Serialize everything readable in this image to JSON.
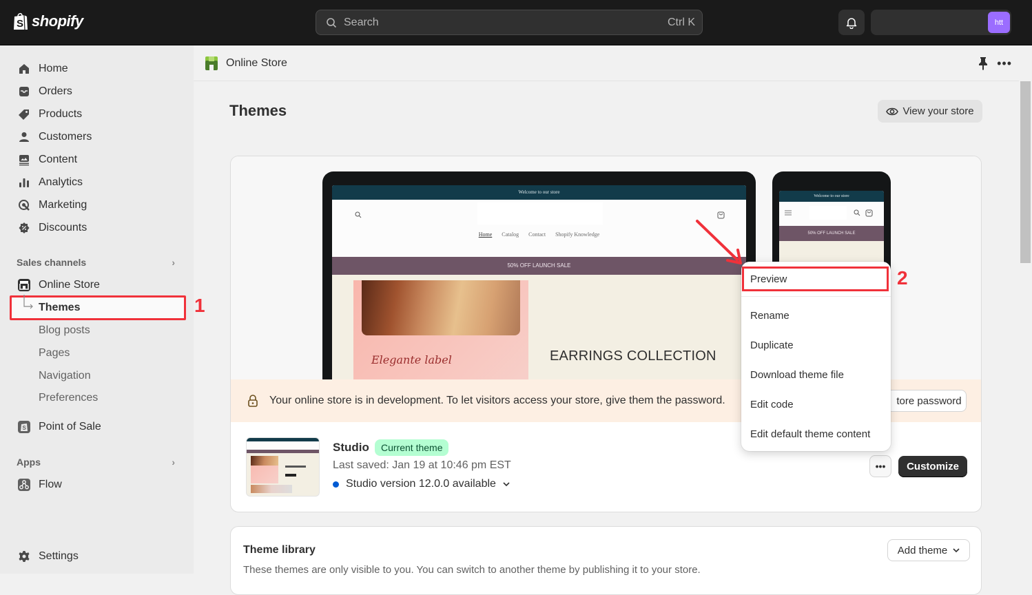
{
  "topbar": {
    "logo_text": "shopify",
    "search_placeholder": "Search",
    "search_shortcut": "Ctrl K",
    "avatar_initials": "htt",
    "avatar_color": "#9b6dff"
  },
  "sidebar": {
    "items": [
      {
        "label": "Home",
        "icon": "home-icon"
      },
      {
        "label": "Orders",
        "icon": "inbox-icon"
      },
      {
        "label": "Products",
        "icon": "tag-icon"
      },
      {
        "label": "Customers",
        "icon": "person-icon"
      },
      {
        "label": "Content",
        "icon": "image-icon"
      },
      {
        "label": "Analytics",
        "icon": "bar-chart-icon"
      },
      {
        "label": "Marketing",
        "icon": "target-icon"
      },
      {
        "label": "Discounts",
        "icon": "discount-icon"
      }
    ],
    "sales_channels_label": "Sales channels",
    "online_store_label": "Online Store",
    "online_store_sub": [
      "Themes",
      "Blog posts",
      "Pages",
      "Navigation",
      "Preferences"
    ],
    "point_of_sale_label": "Point of Sale",
    "apps_label": "Apps",
    "flow_label": "Flow",
    "settings_label": "Settings"
  },
  "annotations": {
    "step1": "1",
    "step2": "2",
    "highlight_color": "#f0313a"
  },
  "header": {
    "title": "Online Store"
  },
  "page": {
    "title": "Themes",
    "view_store_label": "View your store"
  },
  "preview": {
    "announcement": "Welcome to our store",
    "nav": [
      "Home",
      "Catalog",
      "Contact",
      "Shopify Knowledge"
    ],
    "sale": "50% OFF LAUNCH SALE",
    "collection": "EARRINGS COLLECTION",
    "script_text": "Elegante label"
  },
  "banner": {
    "message": "Your online store is in development. To let visitors access your store, give them the password.",
    "button_label": "tore password"
  },
  "current_theme": {
    "name": "Studio",
    "badge": "Current theme",
    "last_saved": "Last saved: Jan 19 at 10:46 pm EST",
    "version": "Studio version 12.0.0 available",
    "more_label": "•••",
    "customize_label": "Customize"
  },
  "theme_menu": {
    "items": [
      "Preview",
      "Rename",
      "Duplicate",
      "Download theme file",
      "Edit code",
      "Edit default theme content"
    ]
  },
  "library": {
    "title": "Theme library",
    "description": "These themes are only visible to you. You can switch to another theme by publishing it to your store.",
    "add_label": "Add theme"
  }
}
